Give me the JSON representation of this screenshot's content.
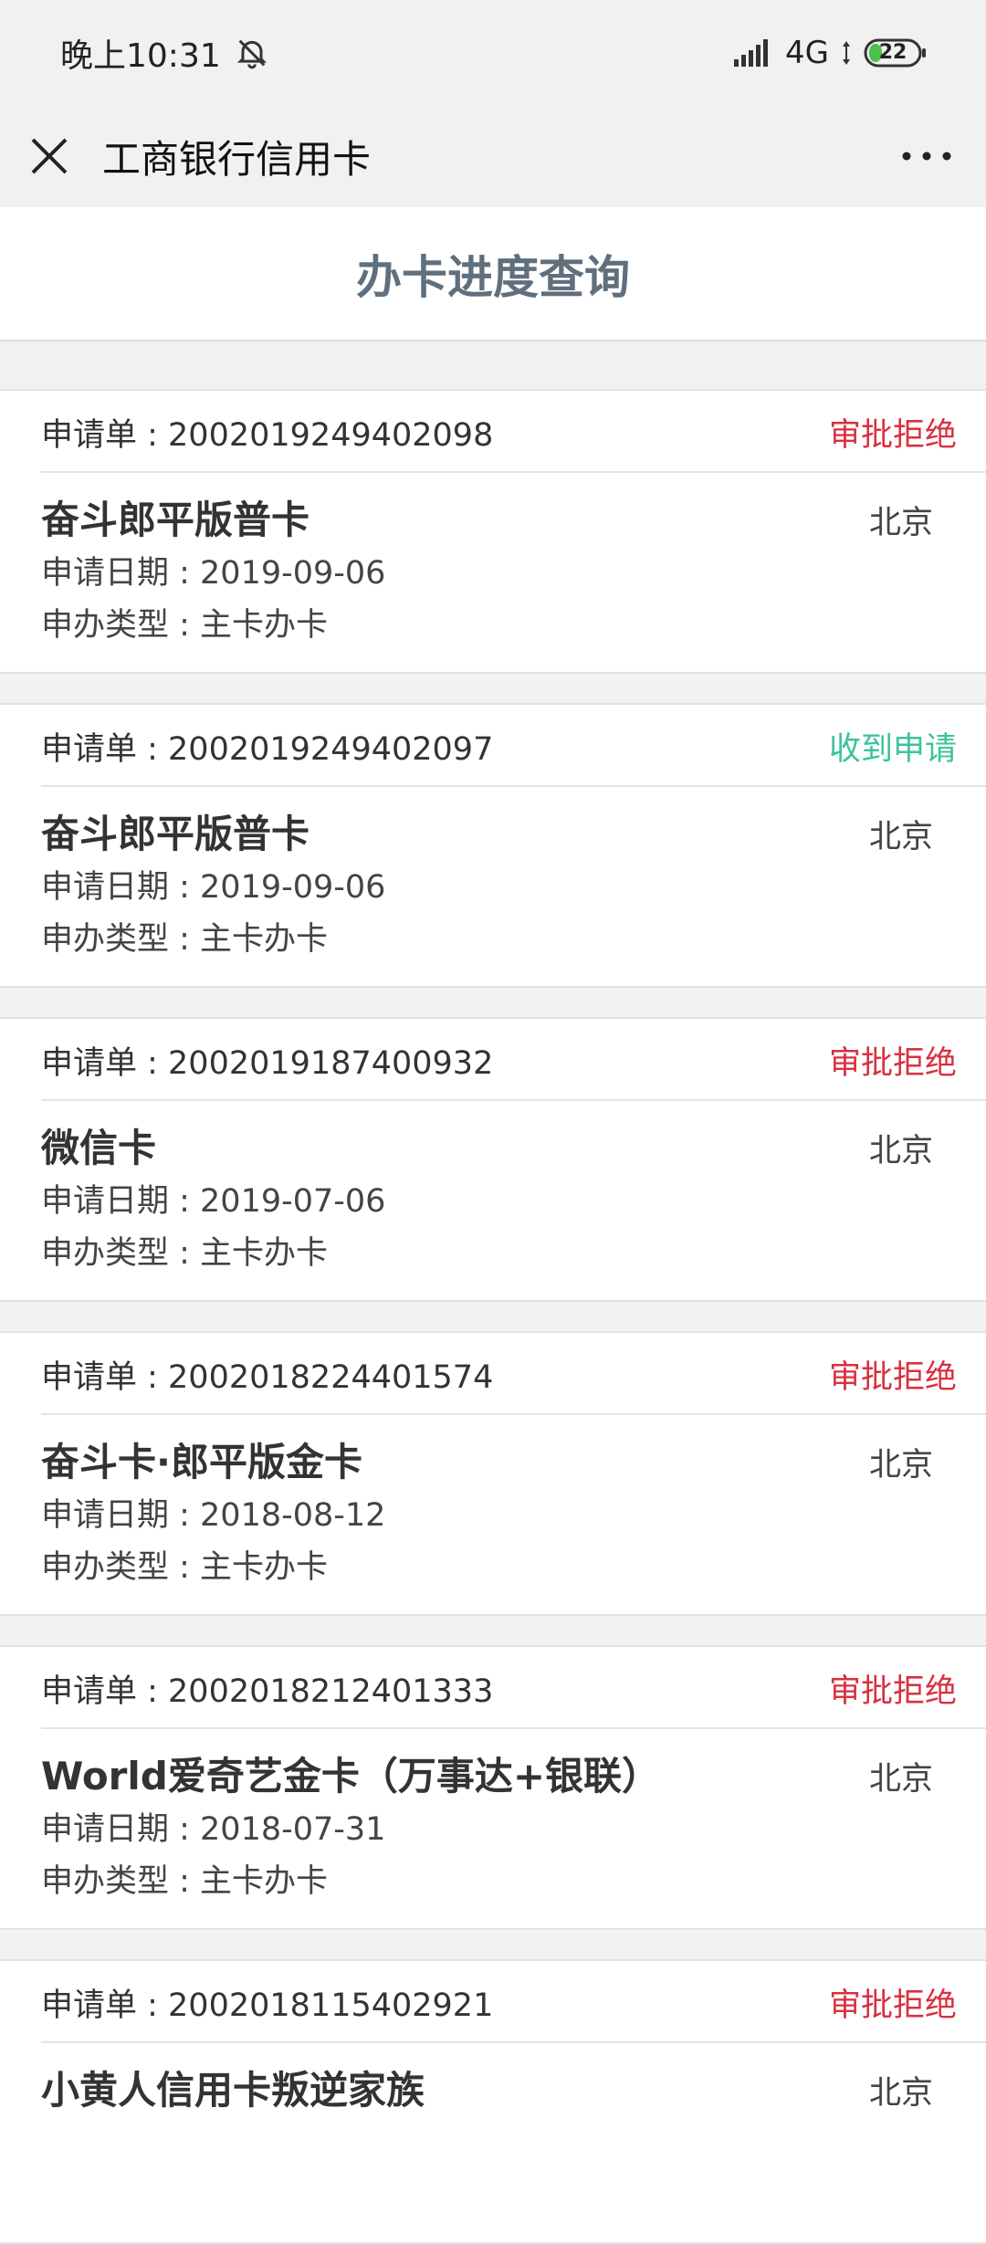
{
  "status_bar": {
    "time": "晚上10:31",
    "network": "4G",
    "battery": "22"
  },
  "nav": {
    "title": "工商银行信用卡"
  },
  "page": {
    "title": "办卡进度查询"
  },
  "applications": [
    {
      "order_label": "申请单 : 2002019249402098",
      "status": "审批拒绝",
      "status_type": "rejected",
      "card_name": "奋斗郎平版普卡",
      "city": "北京",
      "date": "申请日期 : 2019-09-06",
      "type": "申办类型 : 主卡办卡"
    },
    {
      "order_label": "申请单 : 2002019249402097",
      "status": "收到申请",
      "status_type": "received",
      "card_name": "奋斗郎平版普卡",
      "city": "北京",
      "date": "申请日期 : 2019-09-06",
      "type": "申办类型 : 主卡办卡"
    },
    {
      "order_label": "申请单 : 2002019187400932",
      "status": "审批拒绝",
      "status_type": "rejected",
      "card_name": "微信卡",
      "city": "北京",
      "date": "申请日期 : 2019-07-06",
      "type": "申办类型 : 主卡办卡"
    },
    {
      "order_label": "申请单 : 2002018224401574",
      "status": "审批拒绝",
      "status_type": "rejected",
      "card_name": "奋斗卡·郎平版金卡",
      "city": "北京",
      "date": "申请日期 : 2018-08-12",
      "type": "申办类型 : 主卡办卡"
    },
    {
      "order_label": "申请单 : 2002018212401333",
      "status": "审批拒绝",
      "status_type": "rejected",
      "card_name": "World爱奇艺金卡（万事达+银联）",
      "city": "北京",
      "date": "申请日期 : 2018-07-31",
      "type": "申办类型 : 主卡办卡"
    },
    {
      "order_label": "申请单 : 2002018115402921",
      "status": "审批拒绝",
      "status_type": "rejected",
      "card_name": "小黄人信用卡叛逆家族",
      "city": "北京",
      "date": "",
      "type": ""
    }
  ],
  "colors": {
    "rejected": "#d9303f",
    "received": "#3cc39c",
    "title": "#5f6f7d"
  }
}
